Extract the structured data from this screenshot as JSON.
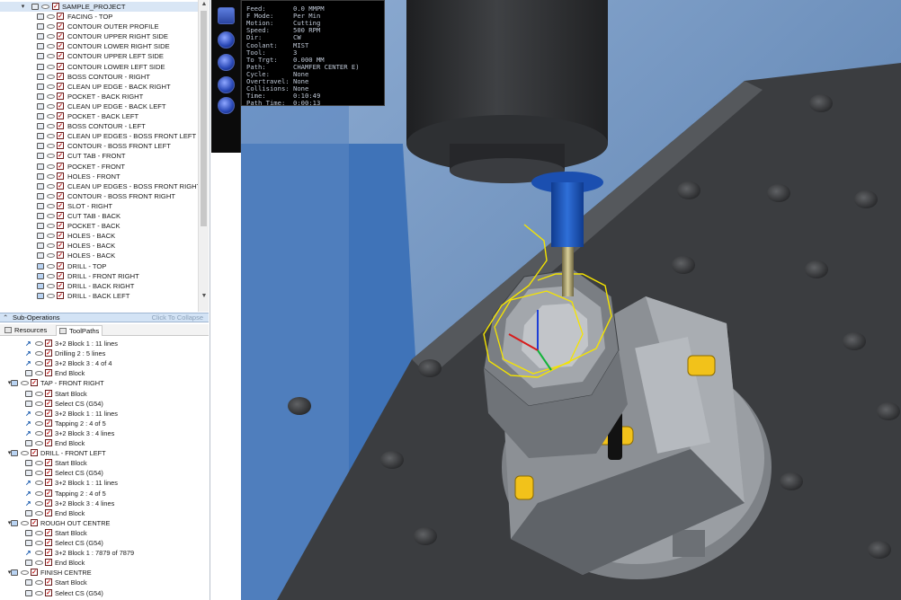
{
  "project": {
    "name": "SAMPLE_PROJECT"
  },
  "operations": [
    {
      "label": "FACING - TOP",
      "icon": "op"
    },
    {
      "label": "CONTOUR OUTER PROFILE",
      "icon": "op"
    },
    {
      "label": "CONTOUR UPPER RIGHT SIDE",
      "icon": "op"
    },
    {
      "label": "CONTOUR LOWER RIGHT SIDE",
      "icon": "op"
    },
    {
      "label": "CONTOUR UPPER LEFT SIDE",
      "icon": "op"
    },
    {
      "label": "CONTOUR LOWER LEFT SIDE",
      "icon": "op"
    },
    {
      "label": "BOSS CONTOUR - RIGHT",
      "icon": "op"
    },
    {
      "label": "CLEAN UP EDGE - BACK RIGHT",
      "icon": "op"
    },
    {
      "label": "POCKET - BACK RIGHT",
      "icon": "op"
    },
    {
      "label": "CLEAN UP EDGE - BACK LEFT",
      "icon": "op"
    },
    {
      "label": "POCKET - BACK LEFT",
      "icon": "op"
    },
    {
      "label": "BOSS CONTOUR - LEFT",
      "icon": "op"
    },
    {
      "label": "CLEAN UP EDGES - BOSS FRONT LEFT",
      "icon": "op"
    },
    {
      "label": "CONTOUR - BOSS FRONT LEFT",
      "icon": "op"
    },
    {
      "label": "CUT TAB - FRONT",
      "icon": "op"
    },
    {
      "label": "POCKET - FRONT",
      "icon": "op"
    },
    {
      "label": "HOLES - FRONT",
      "icon": "op"
    },
    {
      "label": "CLEAN UP EDGES - BOSS FRONT RIGHT",
      "icon": "op"
    },
    {
      "label": "CONTOUR - BOSS FRONT RIGHT",
      "icon": "op"
    },
    {
      "label": "SLOT - RIGHT",
      "icon": "op"
    },
    {
      "label": "CUT TAB - BACK",
      "icon": "op"
    },
    {
      "label": "POCKET - BACK",
      "icon": "op"
    },
    {
      "label": "HOLES - BACK",
      "icon": "op"
    },
    {
      "label": "HOLES - BACK",
      "icon": "op"
    },
    {
      "label": "HOLES - BACK",
      "icon": "op"
    },
    {
      "label": "DRILL - TOP",
      "icon": "drill"
    },
    {
      "label": "DRILL - FRONT RIGHT",
      "icon": "drill"
    },
    {
      "label": "DRILL - BACK RIGHT",
      "icon": "drill"
    },
    {
      "label": "DRILL - BACK LEFT",
      "icon": "drill"
    }
  ],
  "sub_operations_header": {
    "title": "Sub-Operations",
    "collapse": "Click To Collapse"
  },
  "tabs": {
    "resources": "Resources",
    "toolpaths": "ToolPaths"
  },
  "sub_operations": [
    {
      "label": "3+2 Block 1 : 11 lines",
      "indent": 1,
      "kind": "arrow"
    },
    {
      "label": "Drilling 2 : 5 lines",
      "indent": 1,
      "kind": "arrow"
    },
    {
      "label": "3+2 Block 3 : 4 of 4",
      "indent": 1,
      "kind": "arrow"
    },
    {
      "label": "End Block",
      "indent": 1,
      "kind": "block"
    },
    {
      "label": "TAP - FRONT RIGHT",
      "indent": 0,
      "kind": "parent"
    },
    {
      "label": "Start Block",
      "indent": 1,
      "kind": "block"
    },
    {
      "label": "Select CS (G54)",
      "indent": 1,
      "kind": "cs"
    },
    {
      "label": "3+2 Block 1 : 11 lines",
      "indent": 1,
      "kind": "arrow"
    },
    {
      "label": "Tapping 2 : 4 of 5",
      "indent": 1,
      "kind": "arrow"
    },
    {
      "label": "3+2 Block 3 : 4 lines",
      "indent": 1,
      "kind": "arrow"
    },
    {
      "label": "End Block",
      "indent": 1,
      "kind": "block"
    },
    {
      "label": "DRILL - FRONT LEFT",
      "indent": 0,
      "kind": "parent"
    },
    {
      "label": "Start Block",
      "indent": 1,
      "kind": "block"
    },
    {
      "label": "Select CS (G54)",
      "indent": 1,
      "kind": "cs"
    },
    {
      "label": "3+2 Block 1 : 11 lines",
      "indent": 1,
      "kind": "arrow"
    },
    {
      "label": "Tapping 2 : 4 of 5",
      "indent": 1,
      "kind": "arrow"
    },
    {
      "label": "3+2 Block 3 : 4 lines",
      "indent": 1,
      "kind": "arrow"
    },
    {
      "label": "End Block",
      "indent": 1,
      "kind": "block"
    },
    {
      "label": "ROUGH OUT CENTRE",
      "indent": 0,
      "kind": "parent"
    },
    {
      "label": "Start Block",
      "indent": 1,
      "kind": "block"
    },
    {
      "label": "Select CS (G54)",
      "indent": 1,
      "kind": "cs"
    },
    {
      "label": "3+2 Block 1 : 7879 of 7879",
      "indent": 1,
      "kind": "arrow"
    },
    {
      "label": "End Block",
      "indent": 1,
      "kind": "block"
    },
    {
      "label": "FINISH CENTRE",
      "indent": 0,
      "kind": "parent"
    },
    {
      "label": "Start Block",
      "indent": 1,
      "kind": "block"
    },
    {
      "label": "Select CS (G54)",
      "indent": 1,
      "kind": "cs"
    }
  ],
  "info_panel": [
    {
      "key": "Feed:",
      "value": "0.0 MMPM"
    },
    {
      "key": "F Mode:",
      "value": "Per Min"
    },
    {
      "key": "Motion:",
      "value": "Cutting"
    },
    {
      "key": "Speed:",
      "value": "500 RPM"
    },
    {
      "key": "Dir:",
      "value": "CW"
    },
    {
      "key": "Coolant:",
      "value": "MIST"
    },
    {
      "key": "Tool:",
      "value": "3"
    },
    {
      "key": "To Trgt:",
      "value": "0.000 MM"
    },
    {
      "key": "Path:",
      "value": "CHAMFER CENTER E)"
    },
    {
      "key": "Cycle:",
      "value": "None"
    },
    {
      "key": "Overtravel:",
      "value": "None"
    },
    {
      "key": "Collisions:",
      "value": "None"
    },
    {
      "key": "Time:",
      "value": "0:10:49"
    },
    {
      "key": "Path Time:",
      "value": "0:00:13"
    }
  ],
  "colors": {
    "viewport_blue": "#6d8fb8",
    "table_dark": "#3b3d40",
    "spindle_dark": "#2b2c2e",
    "holder_blue": "#1e54b8",
    "clamp_yellow": "#f2c21a",
    "toolpath_yellow": "#f5e400",
    "checkbox_red": "#c21b1b"
  },
  "icons": {
    "expand": "chevron-down-icon",
    "operation": "operation-icon",
    "visibility": "eye-icon",
    "checkbox": "checkbox-icon",
    "drill": "drill-icon",
    "arrow": "motion-arrow-icon"
  }
}
